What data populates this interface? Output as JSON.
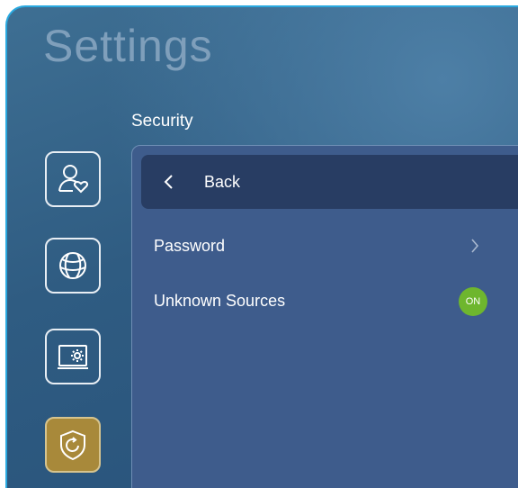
{
  "header": {
    "title": "Settings"
  },
  "section": {
    "label": "Security"
  },
  "sidebar": {
    "items": [
      {
        "icon": "user-heart-icon"
      },
      {
        "icon": "globe-icon"
      },
      {
        "icon": "device-settings-icon"
      },
      {
        "icon": "shield-refresh-icon",
        "active": true
      }
    ]
  },
  "panel": {
    "back_label": "Back",
    "rows": [
      {
        "label": "Password"
      },
      {
        "label": "Unknown Sources",
        "toggle": "ON"
      }
    ]
  },
  "colors": {
    "accent_active": "#a8893a",
    "toggle_on": "#6eb62e",
    "frame": "#2aa9e0"
  }
}
